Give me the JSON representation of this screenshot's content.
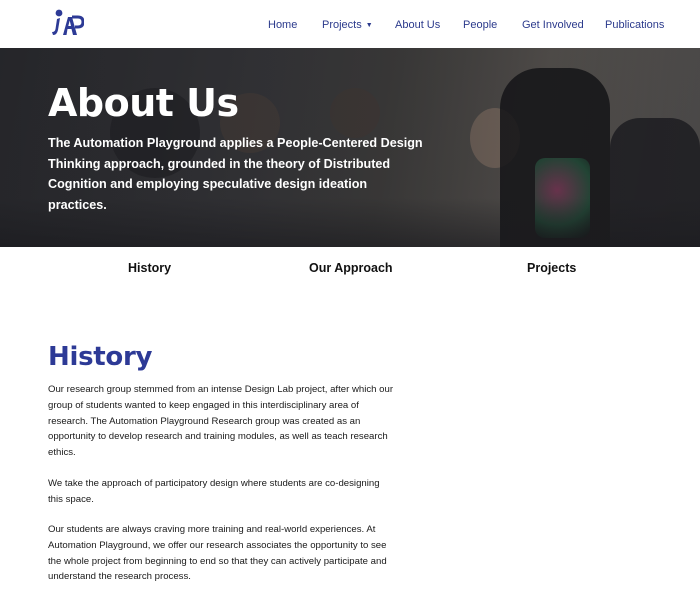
{
  "nav": {
    "home": "Home",
    "projects": "Projects",
    "about": "About Us",
    "people": "People",
    "get_involved": "Get Involved",
    "publications": "Publications"
  },
  "hero": {
    "title": "About Us",
    "description": "The Automation Playground applies a People-Centered Design Thinking approach, grounded in the theory of Distributed Cognition and employing speculative design ideation practices."
  },
  "tabs": {
    "history": "History",
    "approach": "Our Approach",
    "projects": "Projects"
  },
  "history": {
    "heading": "History",
    "p1": "Our research group stemmed from an intense Design Lab project, after which our group of students wanted to keep engaged in this interdisciplinary area of research. The Automation Playground Research group was created as an opportunity to develop research and training modules, as well as teach research ethics.",
    "p2": "We take the approach of participatory design where students are co-designing this space.",
    "p3": "Our students are always craving more training and real-world experiences. At Automation Playground, we offer our research associates the opportunity to see the whole project from beginning to end so that they can actively participate and understand the research process."
  },
  "colors": {
    "brand": "#2d3a96",
    "nav_link": "#2b3a8c"
  }
}
